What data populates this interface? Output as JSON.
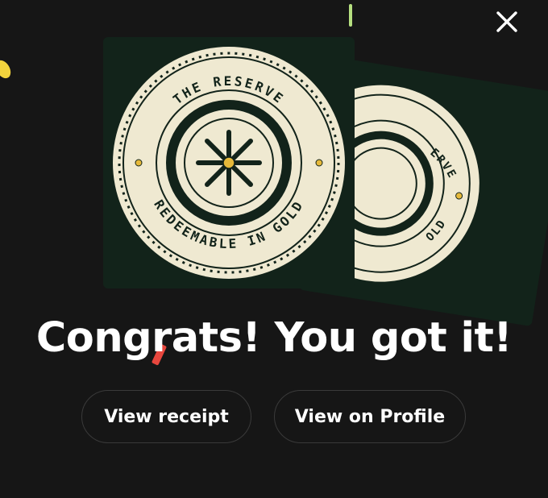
{
  "modal": {
    "close_icon": "close-icon",
    "headline": "Congrats! You got it!",
    "buttons": {
      "receipt_label": "View receipt",
      "profile_label": "View on Profile"
    }
  },
  "badge": {
    "top_text": "THE RESERVE",
    "bottom_text": "REDEEMABLE IN GOLD",
    "icon": "wheel-emblem-icon",
    "back_card_top_text_partial": "ERVE",
    "back_card_bottom_text_partial": "OLD"
  },
  "colors": {
    "background": "#161616",
    "card": "#12231a",
    "coin": "#efe9d1",
    "gold": "#e6b93a",
    "button_border": "#3a3a3a"
  }
}
